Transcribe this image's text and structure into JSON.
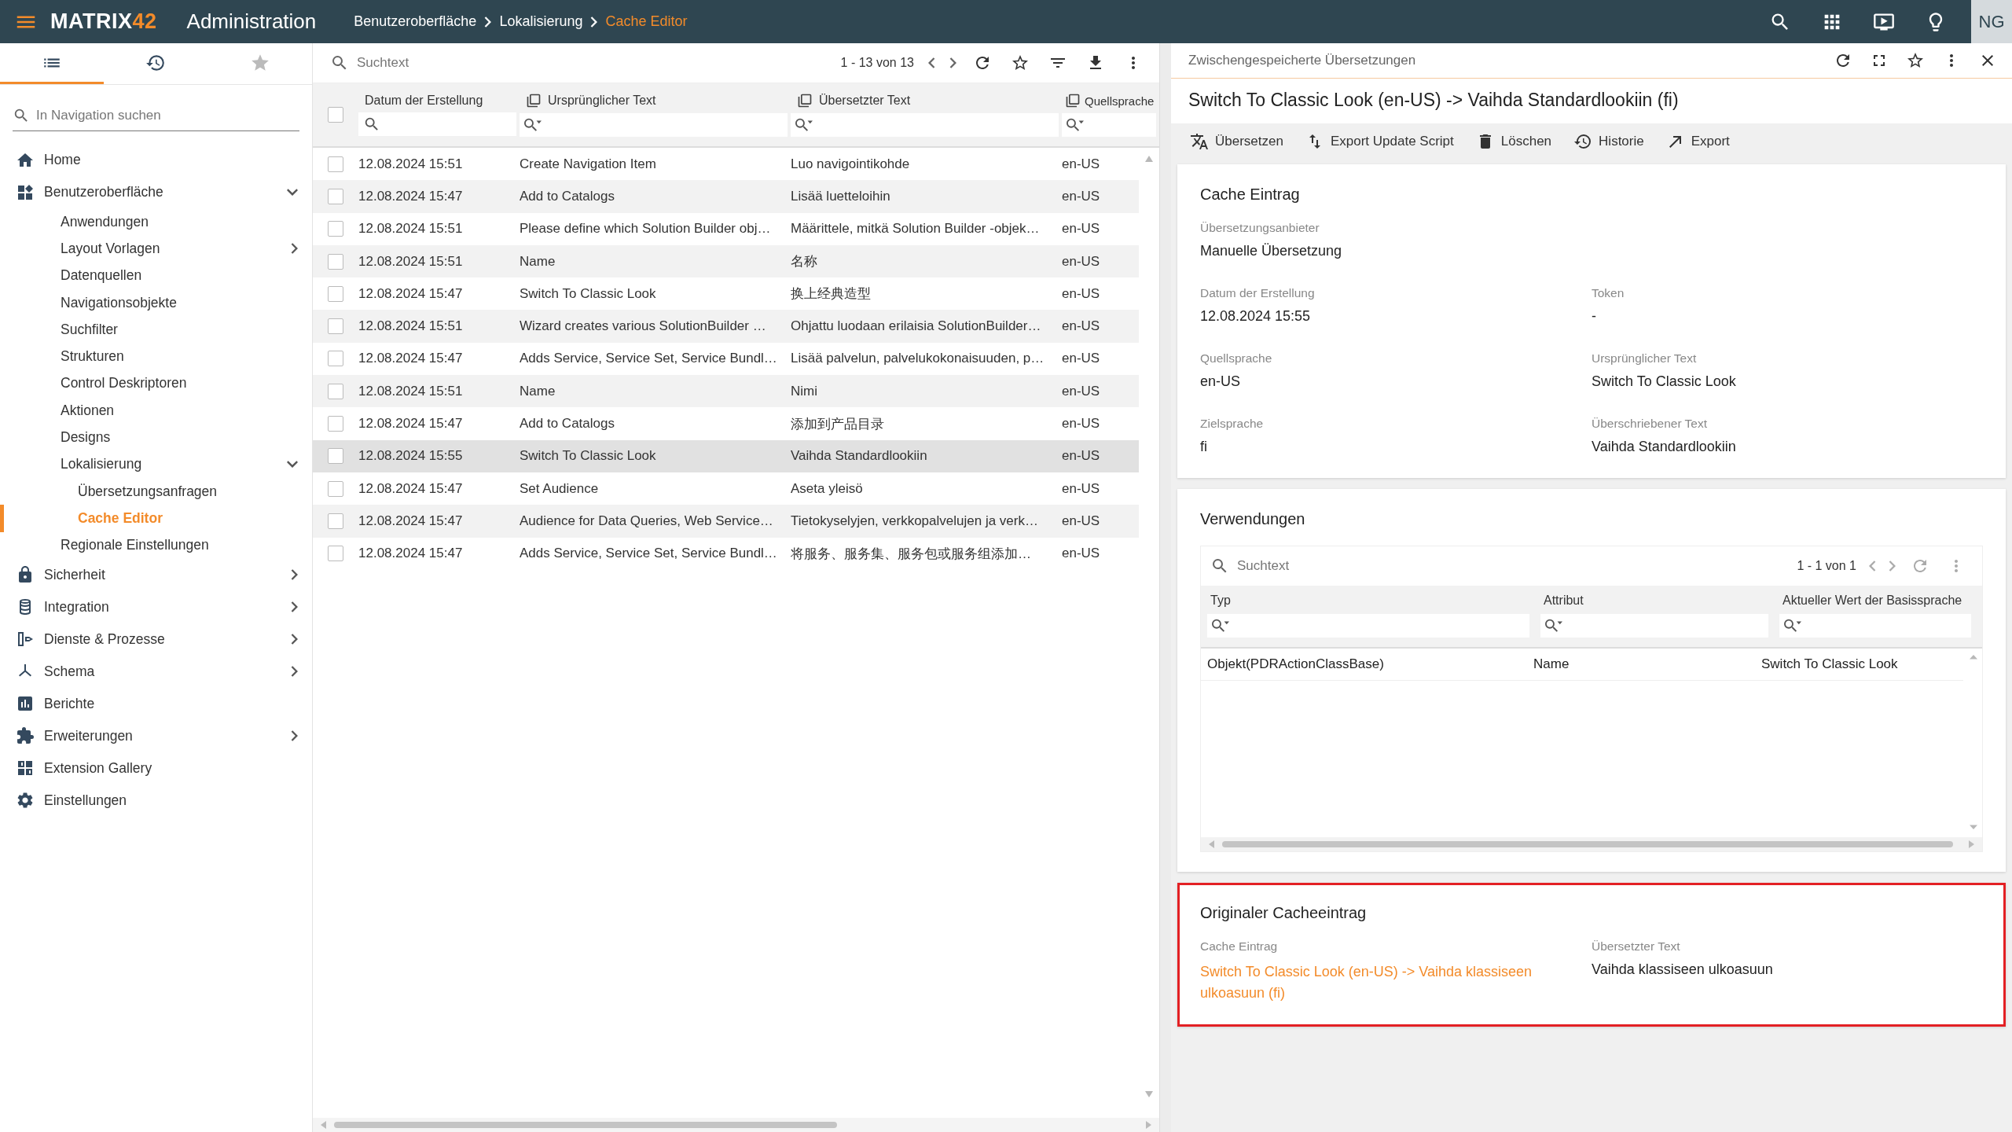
{
  "topbar": {
    "logo": {
      "brand": "MATRIX",
      "suffix": "42"
    },
    "title": "Administration",
    "breadcrumbs": [
      {
        "label": "Benutzeroberfläche",
        "current": false
      },
      {
        "label": "Lokalisierung",
        "current": false
      },
      {
        "label": "Cache Editor",
        "current": true
      }
    ],
    "avatar": "NG"
  },
  "sidebar": {
    "tabs": [
      {
        "selected": true
      },
      {
        "selected": false
      },
      {
        "selected": false
      }
    ],
    "search": {
      "placeholder": "In Navigation suchen"
    },
    "items": [
      {
        "label": "Home",
        "selected": false
      },
      {
        "label": "Benutzeroberfläche",
        "selected": false,
        "expanded": true,
        "children": [
          {
            "label": "Anwendungen",
            "selected": false
          },
          {
            "label": "Layout Vorlagen",
            "selected": false,
            "expanded": false
          },
          {
            "label": "Datenquellen",
            "selected": false
          },
          {
            "label": "Navigationsobjekte",
            "selected": false
          },
          {
            "label": "Suchfilter",
            "selected": false
          },
          {
            "label": "Strukturen",
            "selected": false
          },
          {
            "label": "Control Deskriptoren",
            "selected": false
          },
          {
            "label": "Aktionen",
            "selected": false
          },
          {
            "label": "Designs",
            "selected": false
          },
          {
            "label": "Lokalisierung",
            "selected": false,
            "expanded": true,
            "children": [
              {
                "label": "Übersetzungsanfragen",
                "selected": false
              },
              {
                "label": "Cache Editor",
                "selected": true
              }
            ]
          },
          {
            "label": "Regionale Einstellungen",
            "selected": false
          }
        ]
      },
      {
        "label": "Sicherheit",
        "selected": false,
        "expanded": false
      },
      {
        "label": "Integration",
        "selected": false,
        "expanded": false
      },
      {
        "label": "Dienste & Prozesse",
        "selected": false,
        "expanded": false
      },
      {
        "label": "Schema",
        "selected": false,
        "expanded": false
      },
      {
        "label": "Berichte",
        "selected": false
      },
      {
        "label": "Erweiterungen",
        "selected": false,
        "expanded": false
      },
      {
        "label": "Extension Gallery",
        "selected": false
      },
      {
        "label": "Einstellungen",
        "selected": false
      }
    ]
  },
  "list": {
    "search": {
      "placeholder": "Suchtext"
    },
    "pager": "1 - 13 von 13",
    "all_checked": false,
    "columns": [
      {
        "label": "Datum der Erstellung"
      },
      {
        "label": "Ursprünglicher Text"
      },
      {
        "label": "Übersetzter Text"
      },
      {
        "label": "Quellsprache"
      }
    ],
    "rows": [
      {
        "date": "12.08.2024 15:51",
        "original": "Create Navigation Item",
        "translated": "Luo navigointikohde",
        "source": "en-US",
        "selected": false
      },
      {
        "date": "12.08.2024 15:47",
        "original": "Add to Catalogs",
        "translated": "Lisää luetteloihin",
        "source": "en-US",
        "selected": false
      },
      {
        "date": "12.08.2024 15:51",
        "original": "Please define which Solution Builder obj…",
        "translated": "Määrittele, mitkä Solution Builder -objek…",
        "source": "en-US",
        "selected": false
      },
      {
        "date": "12.08.2024 15:51",
        "original": "Name",
        "translated": "名称",
        "source": "en-US",
        "selected": false
      },
      {
        "date": "12.08.2024 15:47",
        "original": "Switch To Classic Look",
        "translated": "换上经典造型",
        "source": "en-US",
        "selected": false
      },
      {
        "date": "12.08.2024 15:51",
        "original": "Wizard creates various SolutionBuilder …",
        "translated": "Ohjattu luodaan erilaisia SolutionBuilder…",
        "source": "en-US",
        "selected": false
      },
      {
        "date": "12.08.2024 15:47",
        "original": "Adds Service, Service Set, Service Bundl…",
        "translated": "Lisää palvelun, palvelukokonaisuuden, p…",
        "source": "en-US",
        "selected": false
      },
      {
        "date": "12.08.2024 15:51",
        "original": "Name",
        "translated": "Nimi",
        "source": "en-US",
        "selected": false
      },
      {
        "date": "12.08.2024 15:47",
        "original": "Add to Catalogs",
        "translated": "添加到产品目录",
        "source": "en-US",
        "selected": false
      },
      {
        "date": "12.08.2024 15:55",
        "original": "Switch To Classic Look",
        "translated": "Vaihda Standardlookiin",
        "source": "en-US",
        "selected": true
      },
      {
        "date": "12.08.2024 15:47",
        "original": "Set Audience",
        "translated": "Aseta yleisö",
        "source": "en-US",
        "selected": false
      },
      {
        "date": "12.08.2024 15:47",
        "original": "Audience for Data Queries, Web Service…",
        "translated": "Tietokyselyjen, verkkopalvelujen ja verk…",
        "source": "en-US",
        "selected": false
      },
      {
        "date": "12.08.2024 15:47",
        "original": "Adds Service, Service Set, Service Bundl…",
        "translated": "将服务、服务集、服务包或服务组添加…",
        "source": "en-US",
        "selected": false
      }
    ]
  },
  "detail": {
    "caption": "Zwischengespeicherte Übersetzungen",
    "title": "Switch To Classic Look (en-US) -> Vaihda Standardlookiin (fi)",
    "actions": [
      {
        "label": "Übersetzen"
      },
      {
        "label": "Export Update Script"
      },
      {
        "label": "Löschen"
      },
      {
        "label": "Historie"
      },
      {
        "label": "Export"
      }
    ],
    "sections": [
      {
        "kind": "fields",
        "title": "Cache Eintrag",
        "highlighted": false,
        "rows": [
          [
            {
              "label": "Übersetzungsanbieter",
              "value": "Manuelle Übersetzung",
              "link": false
            }
          ],
          [
            {
              "label": "Datum der Erstellung",
              "value": "12.08.2024 15:55",
              "link": false
            },
            {
              "label": "Token",
              "value": "-",
              "link": false
            }
          ],
          [
            {
              "label": "Quellsprache",
              "value": "en-US",
              "link": false
            },
            {
              "label": "Ursprünglicher Text",
              "value": "Switch To Classic Look",
              "link": false
            }
          ],
          [
            {
              "label": "Zielsprache",
              "value": "fi",
              "link": false
            },
            {
              "label": "Überschriebener Text",
              "value": "Vaihda Standardlookiin",
              "link": false
            }
          ]
        ]
      },
      {
        "kind": "table",
        "title": "Verwendungen",
        "highlighted": false,
        "search": {
          "placeholder": "Suchtext"
        },
        "pager": "1 - 1 von 1",
        "columns": [
          {
            "label": "Typ"
          },
          {
            "label": "Attribut"
          },
          {
            "label": "Aktueller Wert der Basissprache"
          }
        ],
        "rows": [
          [
            "Objekt(PDRActionClassBase)",
            "Name",
            "Switch To Classic Look"
          ]
        ]
      },
      {
        "kind": "fields",
        "title": "Originaler Cacheeintrag",
        "highlighted": true,
        "rows": [
          [
            {
              "label": "Cache Eintrag",
              "value": "Switch To Classic Look (en-US) -> Vaihda klassiseen ulkoasuun (fi)",
              "link": true
            },
            {
              "label": "Übersetzter Text",
              "value": "Vaihda klassiseen ulkoasuun",
              "link": false
            }
          ]
        ]
      }
    ]
  }
}
